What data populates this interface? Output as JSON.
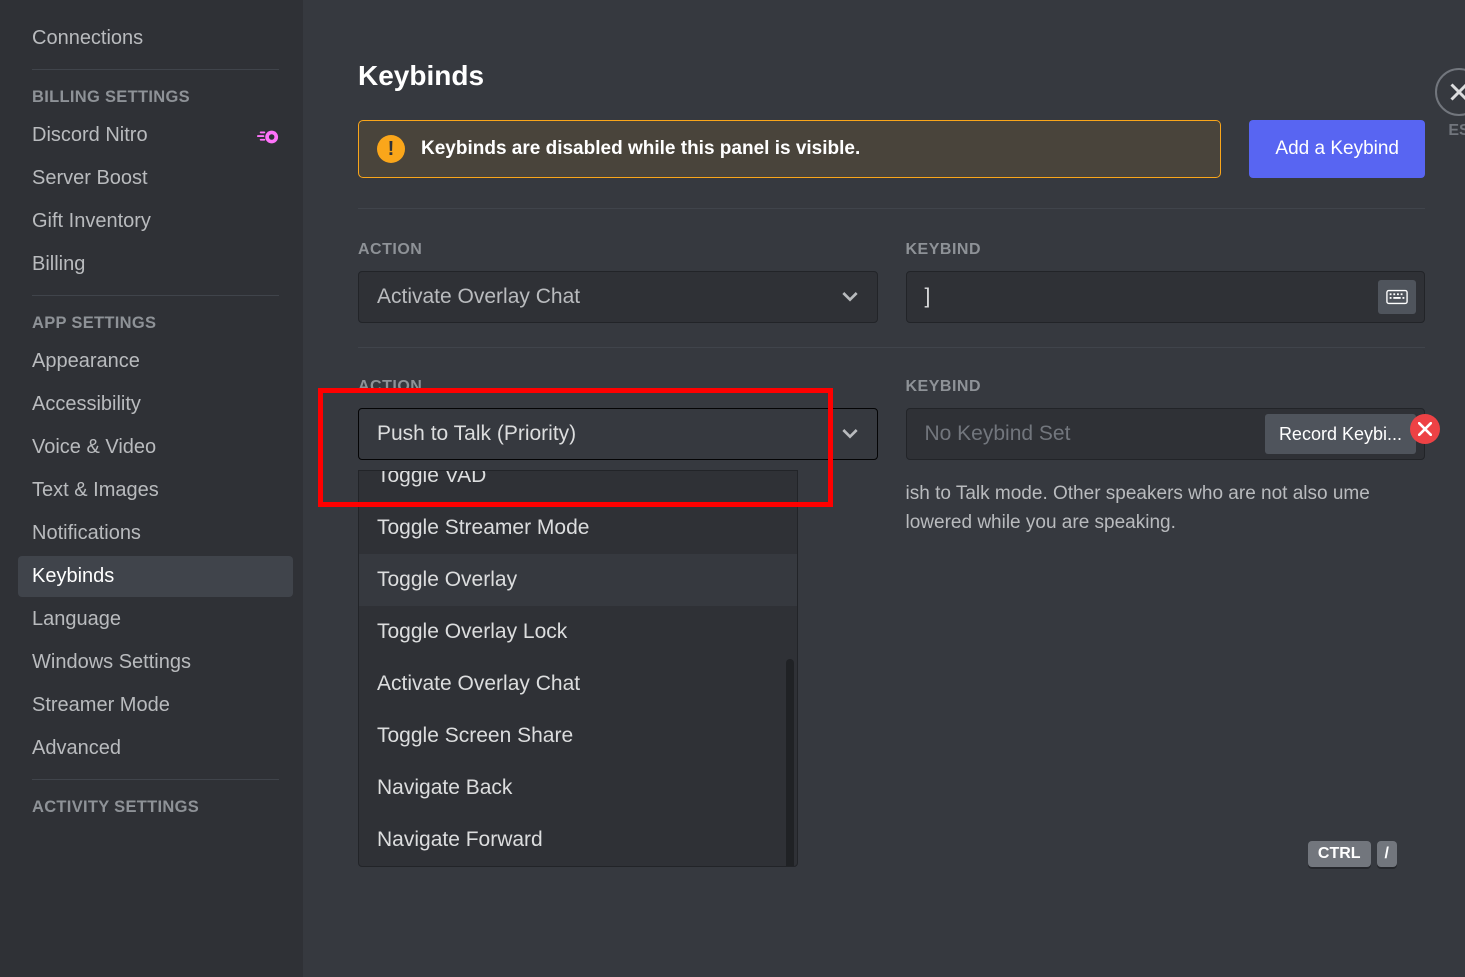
{
  "sidebar": {
    "items_before": [
      {
        "label": "Connections"
      }
    ],
    "section_billing": "BILLING SETTINGS",
    "items_billing": [
      {
        "label": "Discord Nitro",
        "icon": "nitro"
      },
      {
        "label": "Server Boost"
      },
      {
        "label": "Gift Inventory"
      },
      {
        "label": "Billing"
      }
    ],
    "section_app": "APP SETTINGS",
    "items_app": [
      {
        "label": "Appearance"
      },
      {
        "label": "Accessibility"
      },
      {
        "label": "Voice & Video"
      },
      {
        "label": "Text & Images"
      },
      {
        "label": "Notifications"
      },
      {
        "label": "Keybinds",
        "active": true
      },
      {
        "label": "Language"
      },
      {
        "label": "Windows Settings"
      },
      {
        "label": "Streamer Mode"
      },
      {
        "label": "Advanced"
      }
    ],
    "section_activity": "ACTIVITY SETTINGS"
  },
  "main": {
    "title": "Keybinds",
    "warning": "Keybinds are disabled while this panel is visible.",
    "add_button": "Add a Keybind",
    "labels": {
      "action": "ACTION",
      "keybind": "KEYBIND"
    },
    "row1": {
      "action": "Activate Overlay Chat",
      "keybind": "]"
    },
    "row2": {
      "action": "Push to Talk (Priority)",
      "keybind_placeholder": "No Keybind Set",
      "record_btn": "Record Keybi...",
      "description": "ish to Talk mode. Other speakers who are not also ume lowered while you are speaking."
    },
    "dropdown_options": [
      {
        "label": "Toggle VAD",
        "partial": true
      },
      {
        "label": "Toggle Streamer Mode"
      },
      {
        "label": "Toggle Overlay",
        "hover": true
      },
      {
        "label": "Toggle Overlay Lock"
      },
      {
        "label": "Activate Overlay Chat"
      },
      {
        "label": "Toggle Screen Share"
      },
      {
        "label": "Navigate Back"
      },
      {
        "label": "Navigate Forward"
      }
    ],
    "shortcut": {
      "ctrl": "CTRL",
      "slash": "/"
    },
    "esc_label": "ES"
  }
}
